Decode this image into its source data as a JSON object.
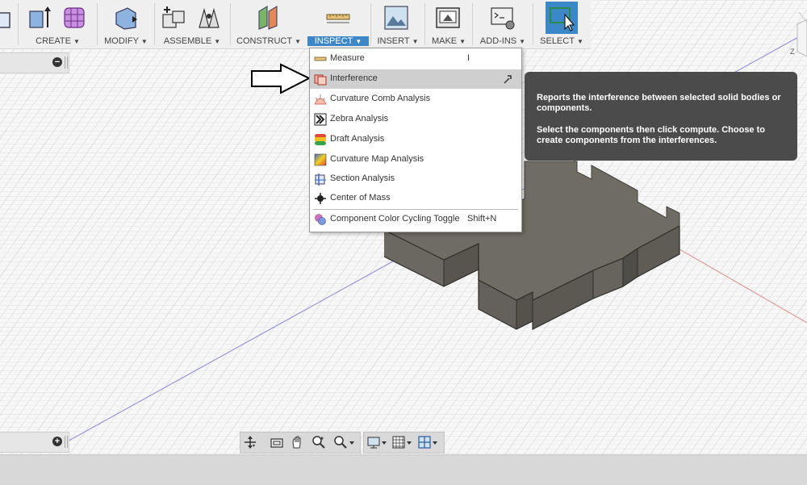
{
  "toolbar": {
    "groups": [
      {
        "label": "CREATE"
      },
      {
        "label": "MODIFY"
      },
      {
        "label": "ASSEMBLE"
      },
      {
        "label": "CONSTRUCT"
      },
      {
        "label": "INSPECT"
      },
      {
        "label": "INSERT"
      },
      {
        "label": "MAKE"
      },
      {
        "label": "ADD-INS"
      },
      {
        "label": "SELECT"
      }
    ],
    "dropdown_glyph": "▼",
    "active": "INSPECT"
  },
  "inspect_menu": {
    "items": [
      {
        "label": "Measure",
        "shortcut": "I",
        "icon": "measure-icon"
      },
      {
        "label": "Interference",
        "shortcut": "",
        "icon": "interference-icon",
        "highlighted": true
      },
      {
        "label": "Curvature Comb Analysis",
        "shortcut": "",
        "icon": "curvature-comb-icon"
      },
      {
        "label": "Zebra Analysis",
        "shortcut": "",
        "icon": "zebra-icon"
      },
      {
        "label": "Draft Analysis",
        "shortcut": "",
        "icon": "draft-icon"
      },
      {
        "label": "Curvature Map Analysis",
        "shortcut": "",
        "icon": "curvature-map-icon"
      },
      {
        "label": "Section Analysis",
        "shortcut": "",
        "icon": "section-icon"
      },
      {
        "label": "Center of Mass",
        "shortcut": "",
        "icon": "center-of-mass-icon"
      },
      {
        "label": "Component Color Cycling Toggle",
        "shortcut": "Shift+N",
        "icon": "color-cycling-icon"
      }
    ]
  },
  "tooltip": {
    "line1": "Reports the interference between selected solid bodies or components.",
    "line2": "Select the components then click compute. Choose to create components from the interferences."
  },
  "left_panels": {
    "top_button": "−",
    "bottom_button": "+"
  },
  "viewcube": {
    "axis_label": "Z"
  },
  "colors": {
    "accent": "#3c87c8",
    "tooltip_bg": "#4b4b4b",
    "menu_highlight": "#cfcfcf",
    "body_top": "#6e6b62",
    "body_side": "#57554e"
  }
}
